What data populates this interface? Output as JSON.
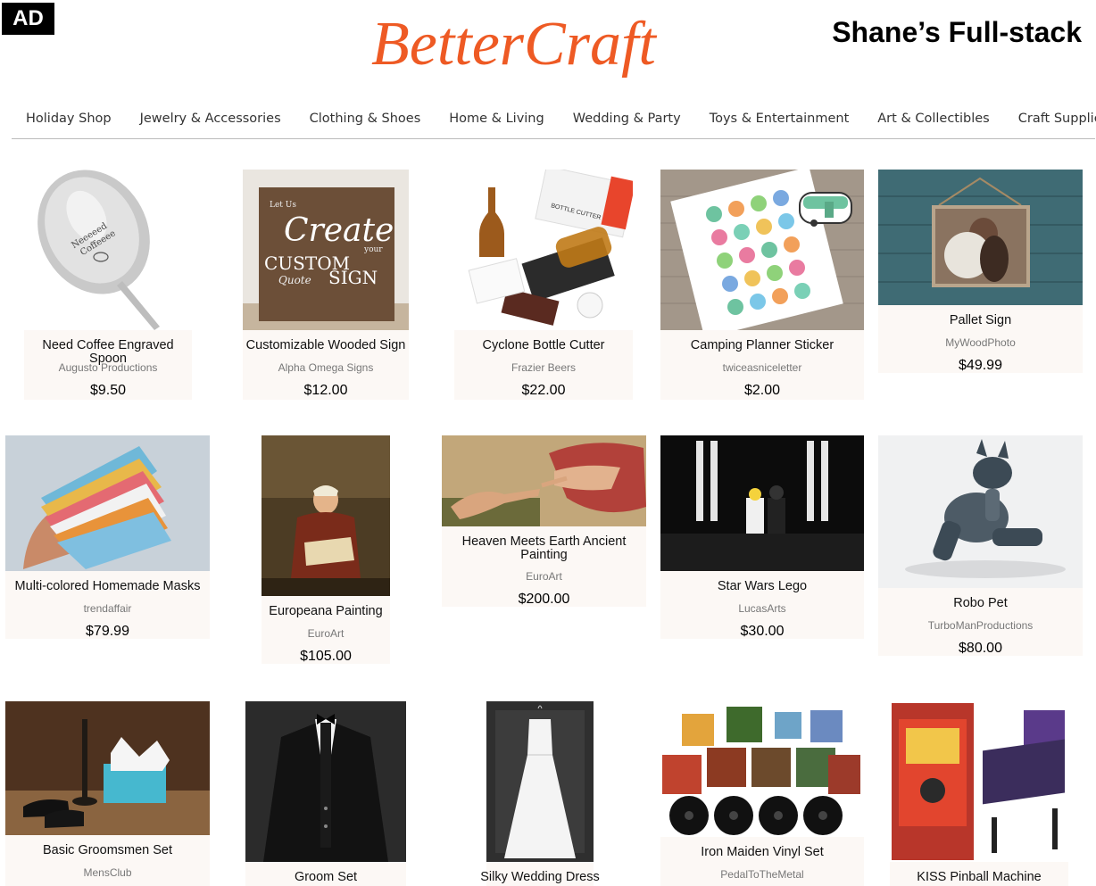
{
  "header": {
    "ad_badge": "AD",
    "logo": "BetterCraft",
    "tagline": "Shane’s Full-stack",
    "brand_color": "#ee5a24"
  },
  "nav": [
    "Holiday Shop",
    "Jewelry & Accessories",
    "Clothing & Shoes",
    "Home & Living",
    "Wedding & Party",
    "Toys & Entertainment",
    "Art & Collectibles",
    "Craft Supplies"
  ],
  "products": [
    {
      "title": "Need Coffee Engraved Spoon",
      "seller": "Augusto Productions",
      "price": "$9.50",
      "image_text": [
        "Neeeeed",
        "Coffeeee"
      ]
    },
    {
      "title": "Customizable Wooded Sign",
      "seller": "Alpha Omega Signs",
      "price": "$12.00",
      "image_text": [
        "Let Us",
        "Create",
        "your",
        "CUSTOM",
        "Quote",
        "SIGN"
      ]
    },
    {
      "title": "Cyclone Bottle Cutter",
      "seller": "Frazier Beers",
      "price": "$22.00",
      "image_text": [
        "BOTTLE CUTTER"
      ]
    },
    {
      "title": "Camping Planner Sticker",
      "seller": "twiceasniceletter",
      "price": "$2.00"
    },
    {
      "title": "Pallet Sign",
      "seller": "MyWoodPhoto",
      "price": "$49.99"
    },
    {
      "title": "Multi-colored Homemade Masks",
      "seller": "trendaffair",
      "price": "$79.99"
    },
    {
      "title": "Europeana Painting",
      "seller": "EuroArt",
      "price": "$105.00"
    },
    {
      "title": "Heaven Meets Earth Ancient Painting",
      "seller": "EuroArt",
      "price": "$200.00"
    },
    {
      "title": "Star Wars Lego",
      "seller": "LucasArts",
      "price": "$30.00"
    },
    {
      "title": "Robo Pet",
      "seller": "TurboManProductions",
      "price": "$80.00"
    },
    {
      "title": "Basic Groomsmen Set",
      "seller": "MensClub",
      "price": ""
    },
    {
      "title": "Groom Set",
      "seller": "",
      "price": ""
    },
    {
      "title": "Silky Wedding Dress",
      "seller": "",
      "price": ""
    },
    {
      "title": "Iron Maiden Vinyl Set",
      "seller": "PedalToTheMetal",
      "price": ""
    },
    {
      "title": "KISS Pinball Machine",
      "seller": "",
      "price": ""
    }
  ]
}
